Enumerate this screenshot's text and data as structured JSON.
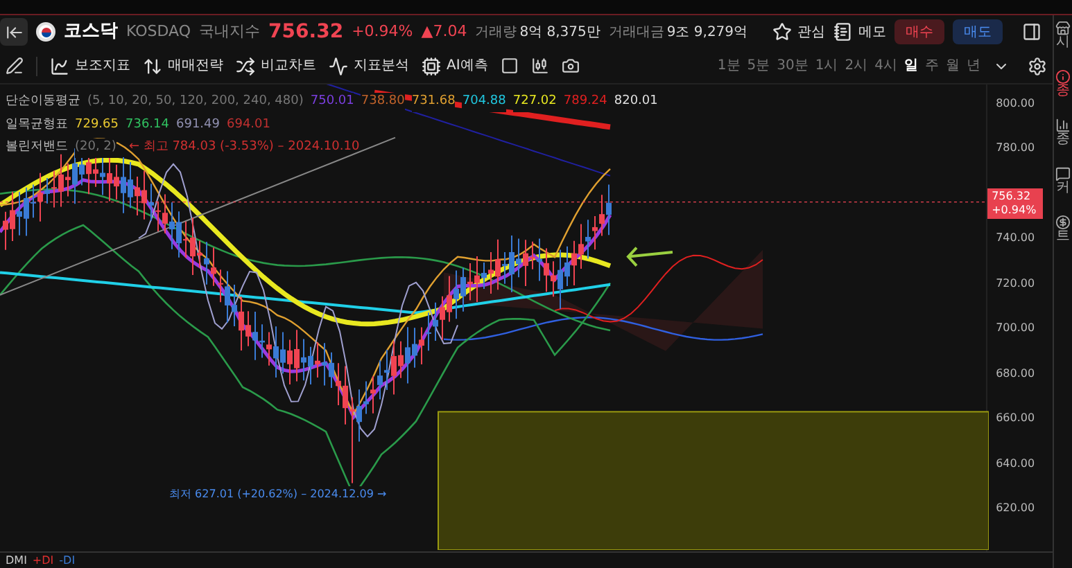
{
  "header": {
    "name": "코스닥",
    "code": "KOSDAQ",
    "market": "국내지수",
    "price": "756.32",
    "change_pct": "+0.94%",
    "change": "▲7.04",
    "volume_label": "거래량",
    "volume": "8억 8,375만",
    "value_label": "거래대금",
    "value": "9조 9,279억"
  },
  "actions": [
    {
      "label": "관심",
      "kind": "star"
    },
    {
      "label": "메모",
      "kind": "memo"
    },
    {
      "label": "매수",
      "kind": "buy"
    },
    {
      "label": "매도",
      "kind": "sell"
    }
  ],
  "toolbar": [
    {
      "label": "보조지표",
      "kind": "indicator"
    },
    {
      "label": "매매전략",
      "kind": "strategy"
    },
    {
      "label": "비교차트",
      "kind": "compare"
    },
    {
      "label": "지표분석",
      "kind": "analysis"
    },
    {
      "label": "AI예측",
      "kind": "ai"
    }
  ],
  "timeframes": [
    {
      "label": "1분",
      "selected": false
    },
    {
      "label": "5분",
      "selected": false
    },
    {
      "label": "30분",
      "selected": false
    },
    {
      "label": "1시",
      "selected": false
    },
    {
      "label": "2시",
      "selected": false
    },
    {
      "label": "4시",
      "selected": false
    },
    {
      "label": "일",
      "selected": true
    },
    {
      "label": "주",
      "selected": false
    },
    {
      "label": "월",
      "selected": false
    },
    {
      "label": "년",
      "selected": false
    }
  ],
  "legend": [
    {
      "name": "단순이동평균",
      "params": "(5, 10, 20, 50, 120, 200, 240, 480)",
      "values": [
        {
          "text": "750.01",
          "color": "#7b3fe0"
        },
        {
          "text": "738.80",
          "color": "#c0622a"
        },
        {
          "text": "731.68",
          "color": "#e0a030"
        },
        {
          "text": "704.88",
          "color": "#20c8e0"
        },
        {
          "text": "727.02",
          "color": "#e8e820"
        },
        {
          "text": "789.24",
          "color": "#e02020"
        },
        {
          "text": "820.01",
          "color": "#e0e0e0"
        }
      ]
    },
    {
      "name": "일목균형표",
      "values": [
        {
          "text": "729.65",
          "color": "#e8c830"
        },
        {
          "text": "736.14",
          "color": "#30c060"
        },
        {
          "text": "691.49",
          "color": "#9090b0"
        },
        {
          "text": "694.01",
          "color": "#c03030"
        }
      ]
    },
    {
      "name": "볼린저밴드",
      "params": "(20, 2)"
    }
  ],
  "high_annotation": "← 최고 784.03 (-3.53%) – 2024.10.10",
  "low_annotation": "최저 627.01 (+20.62%) – 2024.12.09 →",
  "price_axis": [
    "800.00",
    "780.00",
    "740.00",
    "720.00",
    "700.00",
    "680.00",
    "660.00",
    "640.00",
    "620.00"
  ],
  "last_price": {
    "price": "756.32",
    "change": "+0.94%"
  },
  "sidebar": [
    {
      "label": "시",
      "selected": false
    },
    {
      "label": "종",
      "selected": true
    },
    {
      "label": "종",
      "selected": false
    },
    {
      "label": "커",
      "selected": false
    },
    {
      "label": "트",
      "selected": false
    }
  ],
  "indicator_pane": {
    "name": "DMI",
    "series": [
      {
        "text": "+DI",
        "color": "#e03030"
      },
      {
        "text": "-DI",
        "color": "#3a7bd5"
      }
    ]
  }
}
